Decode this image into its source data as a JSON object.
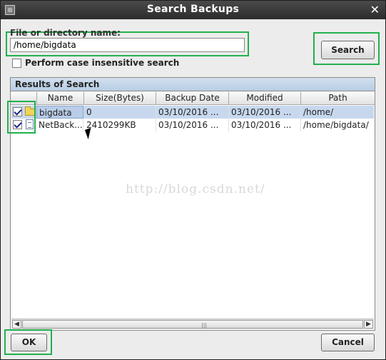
{
  "window": {
    "title": "Search Backups",
    "close_glyph": "✕"
  },
  "search": {
    "field_label": "File or directory name:",
    "value": "/home/bigdata",
    "button_label": "Search",
    "case_insensitive_label": "Perform case insensitive search",
    "case_insensitive_checked": false
  },
  "results": {
    "title": "Results of Search",
    "columns": [
      "Name",
      "Size(Bytes)",
      "Backup Date",
      "Modified",
      "Path"
    ],
    "rows": [
      {
        "checked": true,
        "icon": "folder-icon",
        "name": "bigdata",
        "size": "0",
        "backup_date": "03/10/2016 ...",
        "modified": "03/10/2016 ...",
        "path": "/home/"
      },
      {
        "checked": true,
        "icon": "file-icon",
        "name": "NetBack...",
        "size": "2410299KB",
        "backup_date": "03/10/2016 ...",
        "modified": "03/10/2016 ...",
        "path": "/home/bigdata/"
      }
    ]
  },
  "footer": {
    "ok_label": "OK",
    "cancel_label": "Cancel"
  },
  "watermark": "http://blog.csdn.net/",
  "colors": {
    "highlight": "#22b14c",
    "selection": "#c7d8ee",
    "panel_header": "#c6d7ea"
  }
}
